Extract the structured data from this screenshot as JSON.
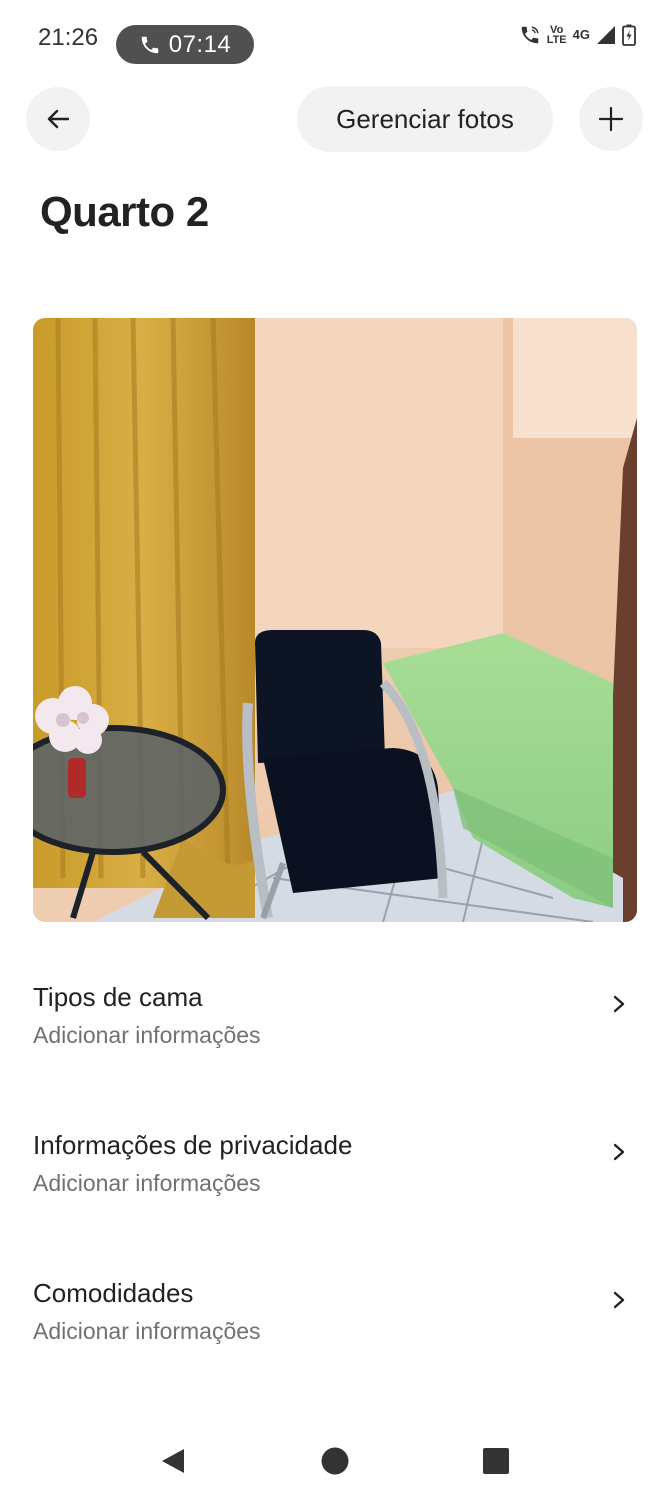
{
  "status_bar": {
    "time": "21:26",
    "call_duration": "07:14",
    "network_top": "Vo",
    "network_bottom": "LTE",
    "network_type": "4G",
    "icons": [
      "wifi-call-icon",
      "signal-icon",
      "battery-charging-icon"
    ]
  },
  "header": {
    "back_icon": "arrow-left-icon",
    "manage_photos_label": "Gerenciar fotos",
    "add_icon": "plus-icon"
  },
  "page": {
    "title": "Quarto 2"
  },
  "photo": {
    "subject": "room-photo"
  },
  "sections": [
    {
      "title": "Tipos de cama",
      "subtitle": "Adicionar informações"
    },
    {
      "title": "Informações de privacidade",
      "subtitle": "Adicionar informações"
    },
    {
      "title": "Comodidades",
      "subtitle": "Adicionar informações"
    }
  ],
  "nav_bar": {
    "icons": [
      "back-triangle-icon",
      "home-circle-icon",
      "recents-square-icon"
    ]
  }
}
